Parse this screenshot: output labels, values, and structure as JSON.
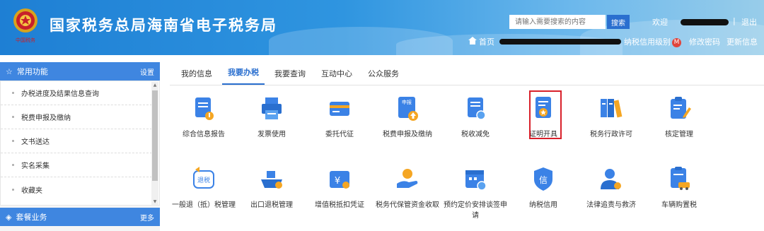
{
  "header": {
    "title": "国家税务总局海南省电子税务局",
    "search_placeholder": "请输入需要搜索的内容",
    "search_button": "搜索",
    "welcome": "欢迎",
    "separator": "|",
    "logout": "退出",
    "home": "首页",
    "credit_level": "纳税信用级别",
    "credit_badge": "M",
    "change_password": "修改密码",
    "update_info": "更新信息",
    "colors": {
      "header_start": "#1e7fd4",
      "header_end": "#98cdea",
      "badge": "#e0443b"
    }
  },
  "sidebar": {
    "common_title": "常用功能",
    "common_action": "设置",
    "items": [
      {
        "label": "办税进度及结果信息查询"
      },
      {
        "label": "税费申报及缴纳"
      },
      {
        "label": "文书送达"
      },
      {
        "label": "实名采集"
      },
      {
        "label": "收藏夹"
      }
    ],
    "package_title": "套餐业务",
    "package_action": "更多"
  },
  "tabs": [
    {
      "label": "我的信息",
      "active": false
    },
    {
      "label": "我要办税",
      "active": true
    },
    {
      "label": "我要查询",
      "active": false
    },
    {
      "label": "互动中心",
      "active": false
    },
    {
      "label": "公众服务",
      "active": false
    }
  ],
  "services_row1": [
    {
      "label": "综合信息报告",
      "icon": "report-mic-icon"
    },
    {
      "label": "发票使用",
      "icon": "printer-icon"
    },
    {
      "label": "委托代征",
      "icon": "card-icon"
    },
    {
      "label": "税费申报及缴纳",
      "icon": "declare-upload-icon"
    },
    {
      "label": "税收减免",
      "icon": "doc-clock-icon"
    },
    {
      "label": "证明开具",
      "icon": "certificate-icon",
      "highlighted": true
    },
    {
      "label": "税务行政许可",
      "icon": "binders-icon"
    },
    {
      "label": "核定管理",
      "icon": "clipboard-edit-icon"
    }
  ],
  "services_row2": [
    {
      "label": "一般退（抵）税管理",
      "icon": "refund-icon"
    },
    {
      "label": "出口退税管理",
      "icon": "ship-icon"
    },
    {
      "label": "增值税抵扣凭证",
      "icon": "yen-ticket-icon"
    },
    {
      "label": "税务代保管资金收取",
      "icon": "hand-money-icon"
    },
    {
      "label": "预约定价安排谈签申请",
      "icon": "calendar-icon"
    },
    {
      "label": "纳税信用",
      "icon": "shield-credit-icon"
    },
    {
      "label": "法律追责与救济",
      "icon": "person-law-icon"
    },
    {
      "label": "车辆购置税",
      "icon": "car-doc-icon"
    }
  ],
  "refund_icon_text": "退税",
  "credit_icon_text": "信",
  "declare_icon_text": "申报"
}
